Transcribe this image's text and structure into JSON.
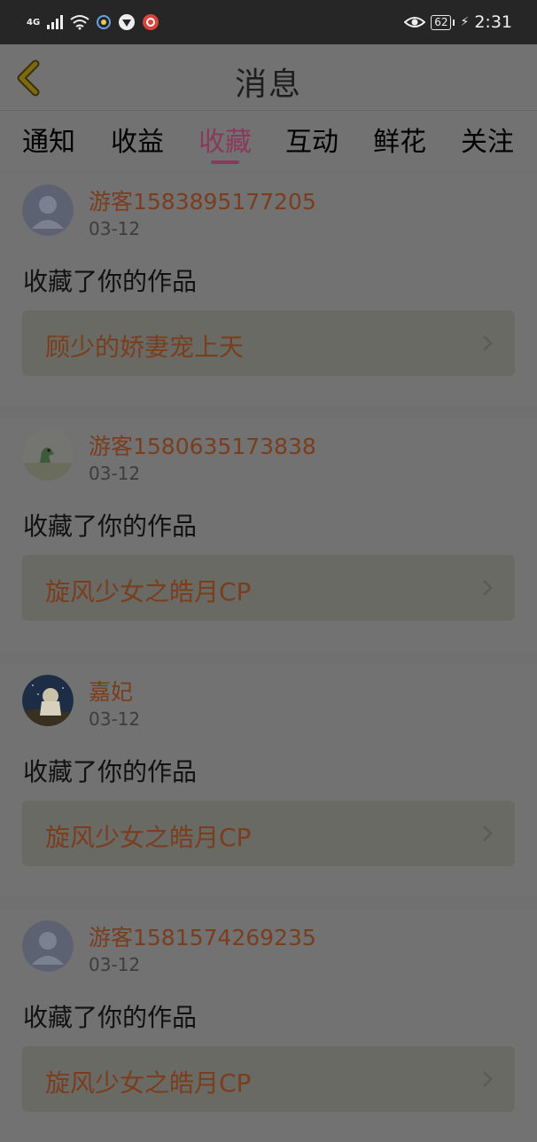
{
  "status_bar": {
    "network": "4G",
    "battery": "62",
    "time": "2:31"
  },
  "header": {
    "title": "消息"
  },
  "tabs": [
    {
      "label": "通知"
    },
    {
      "label": "收益"
    },
    {
      "label": "收藏",
      "active": true
    },
    {
      "label": "互动"
    },
    {
      "label": "鲜花"
    },
    {
      "label": "关注"
    }
  ],
  "items": [
    {
      "user": "游客1583895177205",
      "date": "03-12",
      "action": "收藏了你的作品",
      "work": "顾少的娇妻宠上天",
      "avatar": "default-avatar-icon"
    },
    {
      "user": "游客1580635173838",
      "date": "03-12",
      "action": "收藏了你的作品",
      "work": "旋风少女之皓月CP",
      "avatar": "dinosaur-avatar"
    },
    {
      "user": "嘉妃",
      "date": "03-12",
      "action": "收藏了你的作品",
      "work": "旋风少女之皓月CP",
      "avatar": "photo-avatar"
    },
    {
      "user": "游客1581574269235",
      "date": "03-12",
      "action": "收藏了你的作品",
      "work": "旋风少女之皓月CP",
      "avatar": "default-avatar-icon"
    }
  ],
  "colors": {
    "accent": "#8a3a59",
    "link": "#7a3d1e"
  }
}
